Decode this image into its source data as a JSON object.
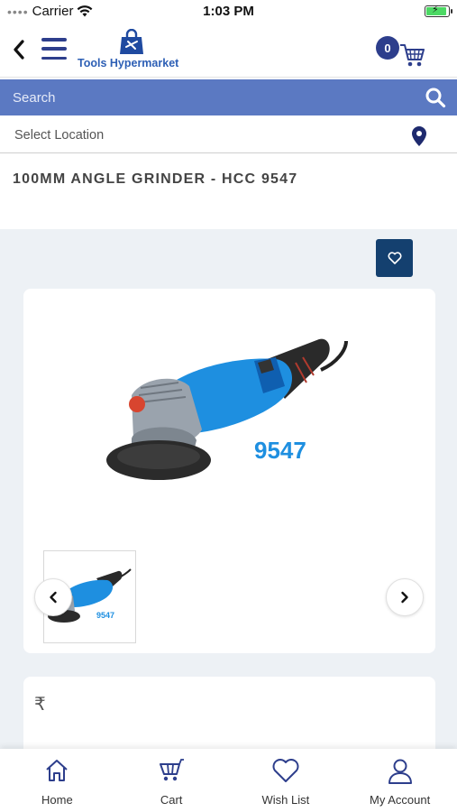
{
  "status_bar": {
    "carrier": "Carrier",
    "time": "1:03 PM"
  },
  "header": {
    "brand": "Tools Hypermarket",
    "cart_count": "0"
  },
  "search": {
    "placeholder": "Search"
  },
  "location": {
    "label": "Select Location"
  },
  "product": {
    "title": "100MM ANGLE GRINDER - HCC 9547",
    "model_label": "9547",
    "currency_symbol": "₹"
  },
  "tabs": [
    {
      "label": "Home",
      "icon": "home-icon"
    },
    {
      "label": "Cart",
      "icon": "cart-icon"
    },
    {
      "label": "Wish List",
      "icon": "heart-icon"
    },
    {
      "label": "My Account",
      "icon": "user-icon"
    }
  ],
  "colors": {
    "brand_navy": "#2d3e8c",
    "search_blue": "#5b79c2",
    "wish_button": "#14406f",
    "tool_blue": "#1e8fe0"
  }
}
